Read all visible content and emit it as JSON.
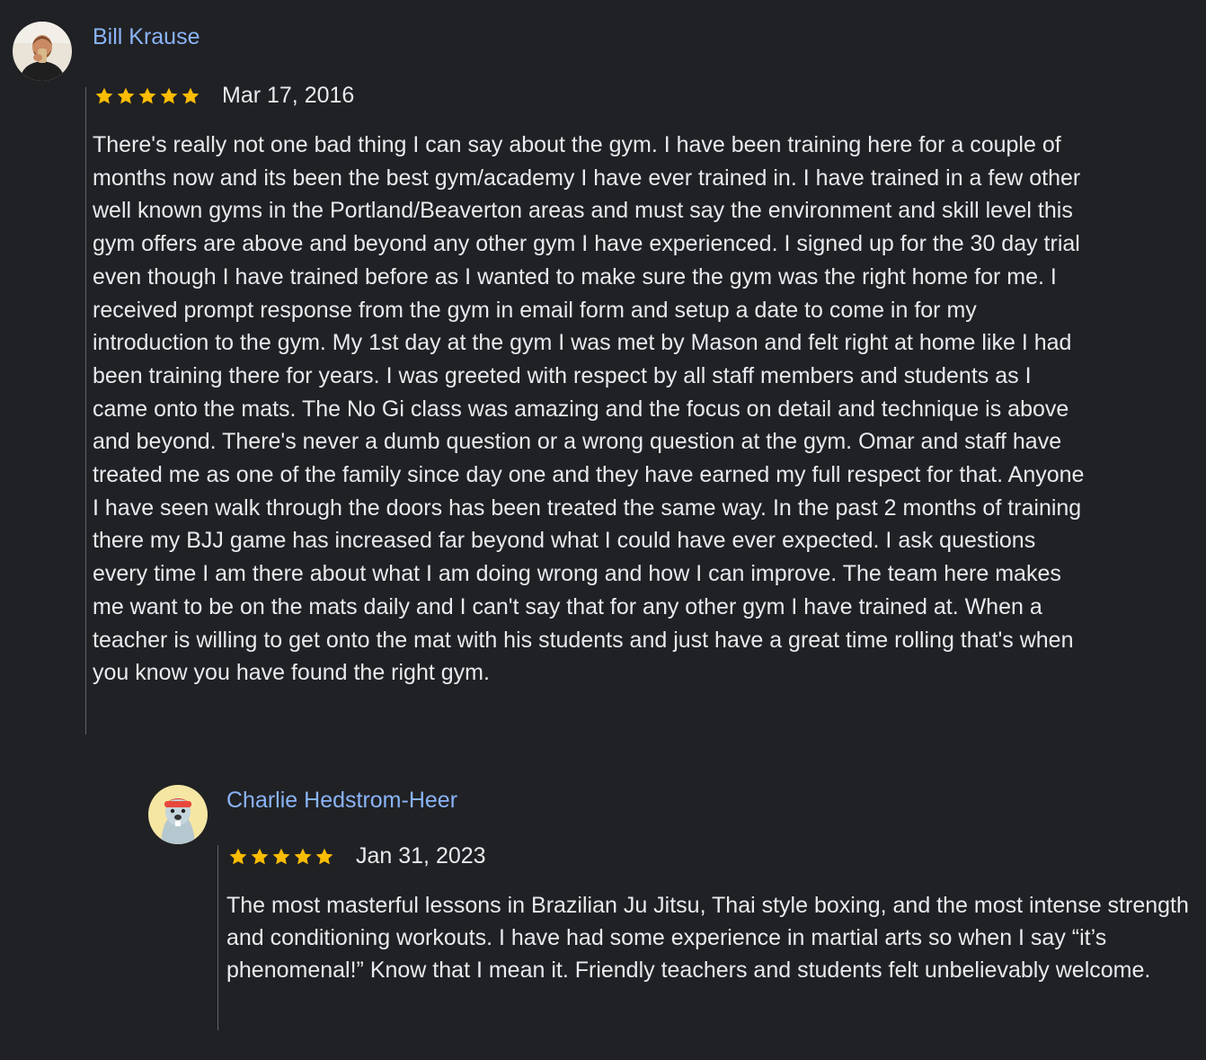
{
  "reviews": [
    {
      "author": "Bill Krause",
      "avatar_icon": "user-avatar-photo",
      "rating": 5,
      "rating_max": 5,
      "date": "Mar 17, 2016",
      "text": "There's really not one bad thing I can say about the gym. I have been training here for a couple of months now and its been the best gym/academy I have ever trained in. I have trained in a few other well known gyms in the Portland/Beaverton areas and must say the environment and skill level this gym offers are above and beyond any other gym I have experienced. I signed up for the 30 day trial even though I have trained before as I wanted to make sure the gym was the right home for me. I received prompt response from the gym in email form and setup a date to come in for my introduction to the gym. My 1st day at the gym I was met by Mason and felt right at home like I had been training there for years. I was greeted with respect by all staff members and students as I came onto the mats. The No Gi class was amazing and the focus on detail and technique is above and beyond. There's never a dumb question or a wrong question at the gym. Omar and staff have treated me as one of the family since day one and they have earned my full respect for that. Anyone I have seen walk through the doors has been treated the same way. In the past 2 months of training there my BJJ game has increased far beyond what I could have ever expected. I ask questions every time I am there about what I am doing wrong and how I can improve. The team here makes me want to be on the mats daily and I can't say that for any other gym I have trained at. When a teacher is willing to get onto the mat with his students and just have a great time rolling that's when you know you have found the right gym."
    },
    {
      "author": "Charlie Hedstrom-Heer",
      "avatar_icon": "cartoon-avatar",
      "rating": 5,
      "rating_max": 5,
      "date": "Jan 31, 2023",
      "text": "The most masterful lessons in Brazilian Ju Jitsu, Thai style boxing, and the most intense strength and conditioning workouts. I have had some experience in martial arts so when I say “it’s phenomenal!” Know that I mean it. Friendly teachers and students felt unbelievably welcome."
    }
  ],
  "colors": {
    "background": "#202124",
    "author_link": "#8ab4f8",
    "star": "#fbbc04",
    "text": "#e8eaed",
    "thread_line": "#5f6368"
  }
}
